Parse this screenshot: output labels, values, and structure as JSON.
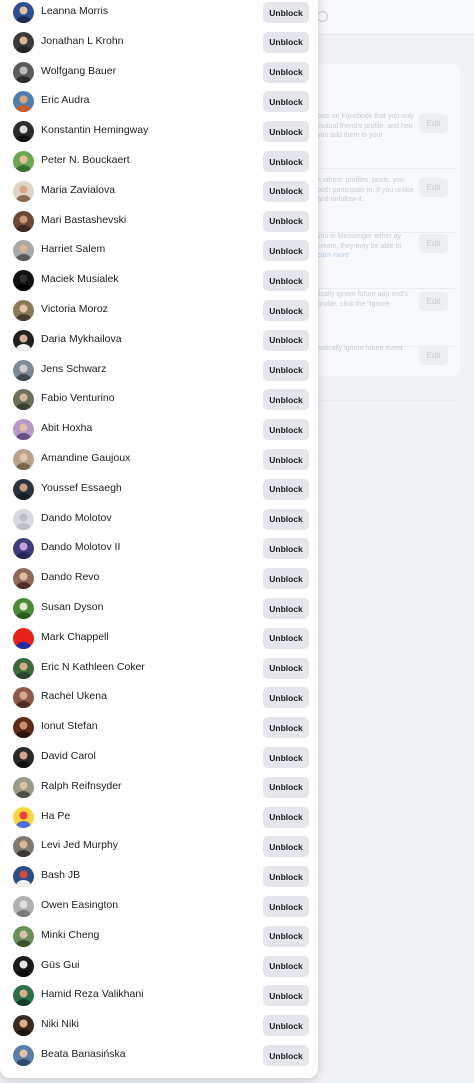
{
  "background": {
    "settings_rows": [
      {
        "text": "osts on Facebook that you only mutual friend's profile, and hen you add them to your",
        "link": "",
        "edit_label": "Edit"
      },
      {
        "text": "h others' profiles, posts, you both participate in. If you unlike and unfollow it.",
        "link": "",
        "edit_label": "Edit"
      },
      {
        "text": "you in Messenger either ay create, they may be able to",
        "link": "earn more",
        "edit_label": "Edit"
      },
      {
        "text": "tically ignore future app end's profile, click the \"Ignore",
        "link": "",
        "edit_label": "Edit"
      },
      {
        "text": "natically ignore future event",
        "link": "",
        "edit_label": "Edit"
      }
    ]
  },
  "blocked_list": {
    "button_label": "Unblock",
    "users": [
      {
        "name": "Leanna Morris",
        "avatar": {
          "bg": "#2d4f8f",
          "head": "#e2c2a6",
          "body": "#1b2c52"
        }
      },
      {
        "name": "Jonathan L Krohn",
        "avatar": {
          "bg": "#3a3a3a",
          "head": "#d5b79b",
          "body": "#222222"
        }
      },
      {
        "name": "Wolfgang Bauer",
        "avatar": {
          "bg": "#5b5b5b",
          "head": "#bdbdbd",
          "body": "#2b2b2b"
        }
      },
      {
        "name": "Eric Audra",
        "avatar": {
          "bg": "#4f7fb0",
          "head": "#d9a77f",
          "body": "#c85b2c"
        }
      },
      {
        "name": "Konstantin Hemingway",
        "avatar": {
          "bg": "#2b2b2b",
          "head": "#dddddd",
          "body": "#111111"
        }
      },
      {
        "name": "Peter N. Bouckaert",
        "avatar": {
          "bg": "#6aa84f",
          "head": "#e6c29b",
          "body": "#3c6e2f"
        }
      },
      {
        "name": "Maria Zavialova",
        "avatar": {
          "bg": "#e0d4c4",
          "head": "#d9a88a",
          "body": "#8c6b52"
        }
      },
      {
        "name": "Mari Bastashevski",
        "avatar": {
          "bg": "#6a4a35",
          "head": "#c79a7b",
          "body": "#3a2a20"
        }
      },
      {
        "name": "Harriet Salem",
        "avatar": {
          "bg": "#a8a8a8",
          "head": "#d8b59a",
          "body": "#5a5a5a"
        }
      },
      {
        "name": "Maciek Musialek",
        "avatar": {
          "bg": "#111111",
          "head": "#2f2f2f",
          "body": "#000000"
        }
      },
      {
        "name": "Victoria Moroz",
        "avatar": {
          "bg": "#8a7a5a",
          "head": "#e3c3a3",
          "body": "#4a3b2b"
        }
      },
      {
        "name": "Daria Mykhailova",
        "avatar": {
          "bg": "#1f1f1f",
          "head": "#d6b095",
          "body": "#f0f0f0"
        }
      },
      {
        "name": "Jens Schwarz",
        "avatar": {
          "bg": "#7d8a94",
          "head": "#cfcfcf",
          "body": "#3e4a52"
        }
      },
      {
        "name": "Fabio Venturino",
        "avatar": {
          "bg": "#6b705a",
          "head": "#d6b597",
          "body": "#3d4133"
        }
      },
      {
        "name": "Abit Hoxha",
        "avatar": {
          "bg": "#b59ac9",
          "head": "#e0c0a5",
          "body": "#6b4e86"
        }
      },
      {
        "name": "Amandine Gaujoux",
        "avatar": {
          "bg": "#b7a48a",
          "head": "#e4c6aa",
          "body": "#7a6550"
        }
      },
      {
        "name": "Youssef Essaegh",
        "avatar": {
          "bg": "#2c3340",
          "head": "#c89d7c",
          "body": "#1a1f27"
        }
      },
      {
        "name": "Dando Molotov",
        "avatar": {
          "bg": "#d8dadf",
          "head": "#bcc0c4",
          "body": "#bcc0c4"
        }
      },
      {
        "name": "Dando Molotov II",
        "avatar": {
          "bg": "#3d3d7a",
          "head": "#c5a1d9",
          "body": "#262657"
        }
      },
      {
        "name": "Dando Revo",
        "avatar": {
          "bg": "#8f6a5a",
          "head": "#e1b99d",
          "body": "#502f24"
        }
      },
      {
        "name": "Susan Dyson",
        "avatar": {
          "bg": "#4c8a3a",
          "head": "#dbe8cf",
          "body": "#2d5a22"
        }
      },
      {
        "name": "Mark Chappell",
        "avatar": {
          "bg": "#e4241b",
          "head": "#e4241b",
          "body": "#1a2ea8"
        }
      },
      {
        "name": "Eric N Kathleen Coker",
        "avatar": {
          "bg": "#3b6b3b",
          "head": "#d2ae8f",
          "body": "#2a472a"
        }
      },
      {
        "name": "Rachel Ukena",
        "avatar": {
          "bg": "#8c5a4a",
          "head": "#d8a78a",
          "body": "#4e2e24"
        }
      },
      {
        "name": "Ionut Stefan",
        "avatar": {
          "bg": "#5a2a1a",
          "head": "#c98f6b",
          "body": "#2e140c"
        }
      },
      {
        "name": "David Carol",
        "avatar": {
          "bg": "#2a2a2a",
          "head": "#cfa78a",
          "body": "#111111"
        }
      },
      {
        "name": "Ralph Reifnsyder",
        "avatar": {
          "bg": "#9a9a8a",
          "head": "#d9bfa5",
          "body": "#4f4f45"
        }
      },
      {
        "name": "Ha Pe",
        "avatar": {
          "bg": "#ffd33d",
          "head": "#e8433a",
          "body": "#4b6fd6"
        }
      },
      {
        "name": "Levi Jed Murphy",
        "avatar": {
          "bg": "#7f7a72",
          "head": "#d8b89a",
          "body": "#3b3833"
        }
      },
      {
        "name": "Bash JB",
        "avatar": {
          "bg": "#2c4f8a",
          "head": "#d74a3a",
          "body": "#f2f2f2"
        }
      },
      {
        "name": "Owen Easington",
        "avatar": {
          "bg": "#b0b0b0",
          "head": "#e0e0e0",
          "body": "#7a7a7a"
        }
      },
      {
        "name": "Minki Cheng",
        "avatar": {
          "bg": "#6b8f5a",
          "head": "#d9c2a8",
          "body": "#3b5530"
        }
      },
      {
        "name": "Güs Gui",
        "avatar": {
          "bg": "#1a1a1a",
          "head": "#e6e6e6",
          "body": "#0a0a0a"
        }
      },
      {
        "name": "Hamid Reza Valikhani",
        "avatar": {
          "bg": "#2a6e4a",
          "head": "#d6b294",
          "body": "#163d29"
        }
      },
      {
        "name": "Niki Niki",
        "avatar": {
          "bg": "#3a2a20",
          "head": "#d9b08f",
          "body": "#1e140f"
        }
      },
      {
        "name": "Beata Banasińska",
        "avatar": {
          "bg": "#5b7fa8",
          "head": "#e0c3a8",
          "body": "#2e4a6e"
        }
      }
    ]
  }
}
